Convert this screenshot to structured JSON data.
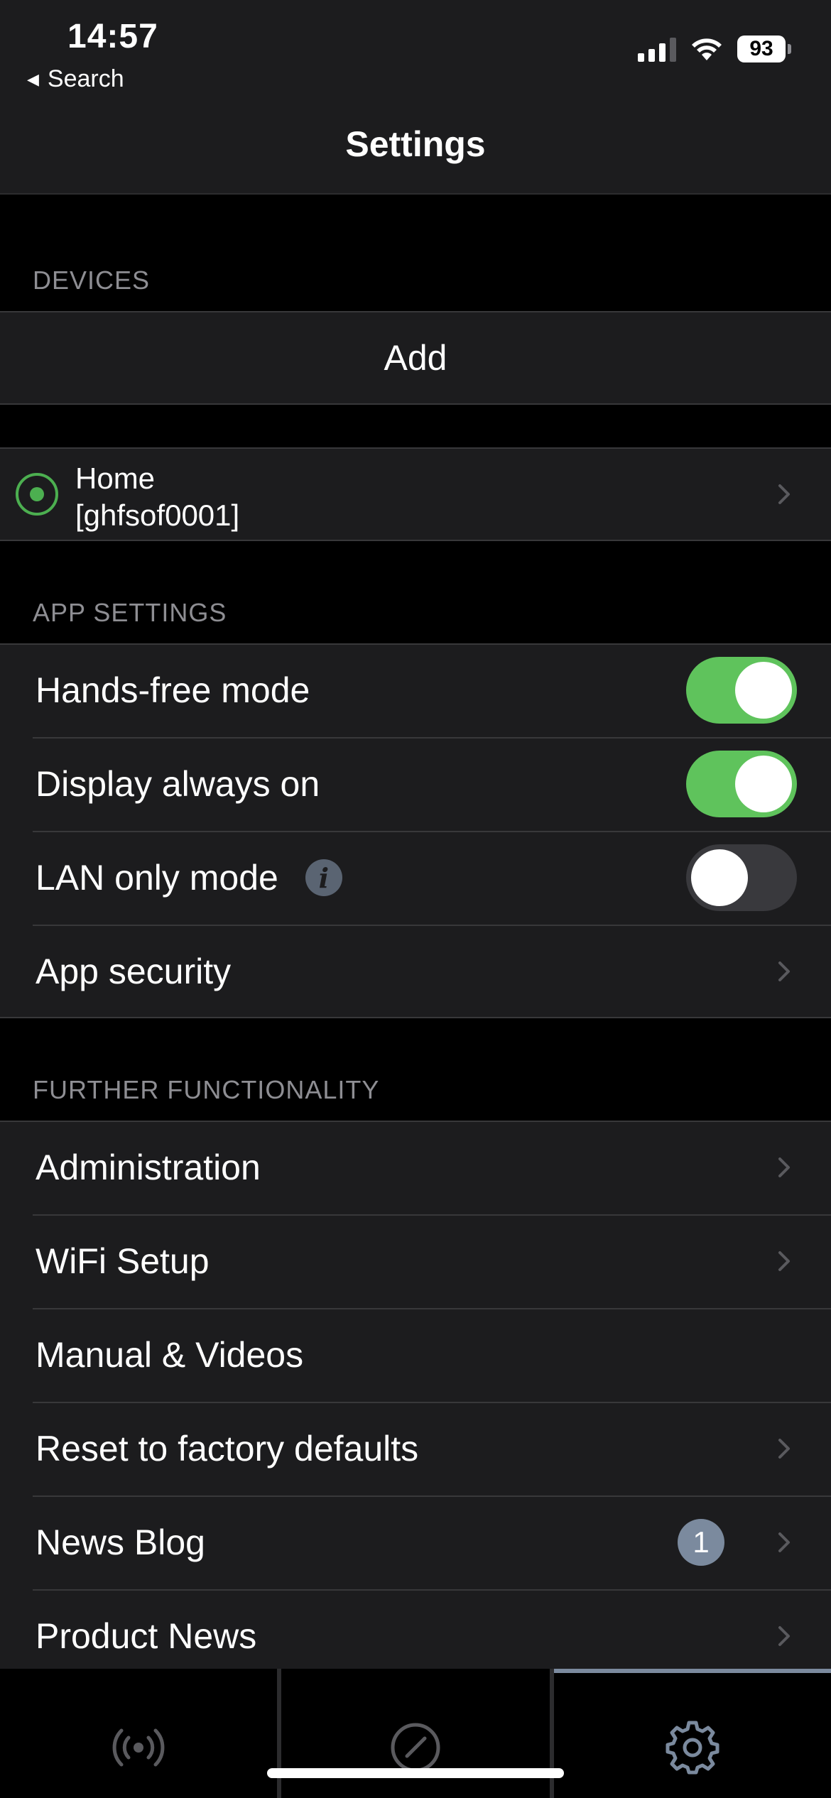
{
  "status_bar": {
    "time": "14:57",
    "back_label": "Search",
    "battery": "93",
    "signal_icon": "cellular-signal-icon",
    "wifi_icon": "wifi-icon"
  },
  "nav": {
    "title": "Settings"
  },
  "sections": {
    "devices": {
      "header": "DEVICES",
      "add_label": "Add",
      "device": {
        "name": "Home",
        "id": "[ghfsof0001]",
        "selected": true
      }
    },
    "app_settings": {
      "header": "APP SETTINGS",
      "hands_free": {
        "label": "Hands-free mode",
        "on": true
      },
      "display_on": {
        "label": "Display always on",
        "on": true
      },
      "lan_only": {
        "label": "LAN only mode",
        "on": false,
        "info": "i"
      },
      "app_security": {
        "label": "App security"
      }
    },
    "further": {
      "header": "FURTHER FUNCTIONALITY",
      "items": [
        {
          "label": "Administration",
          "chevron": true
        },
        {
          "label": "WiFi Setup",
          "chevron": true
        },
        {
          "label": "Manual & Videos",
          "chevron": false
        },
        {
          "label": "Reset to factory defaults",
          "chevron": true
        },
        {
          "label": "News Blog",
          "chevron": true,
          "badge": "1"
        },
        {
          "label": "Product News",
          "chevron": true
        }
      ]
    }
  },
  "tab_bar": {
    "tabs": [
      {
        "icon": "broadcast-icon",
        "active": false
      },
      {
        "icon": "clock-icon",
        "active": false
      },
      {
        "icon": "gear-icon",
        "active": true
      }
    ]
  },
  "colors": {
    "toggle_on": "#5fc35c",
    "accent_green": "#4caf50",
    "badge": "#7b8a9e"
  }
}
